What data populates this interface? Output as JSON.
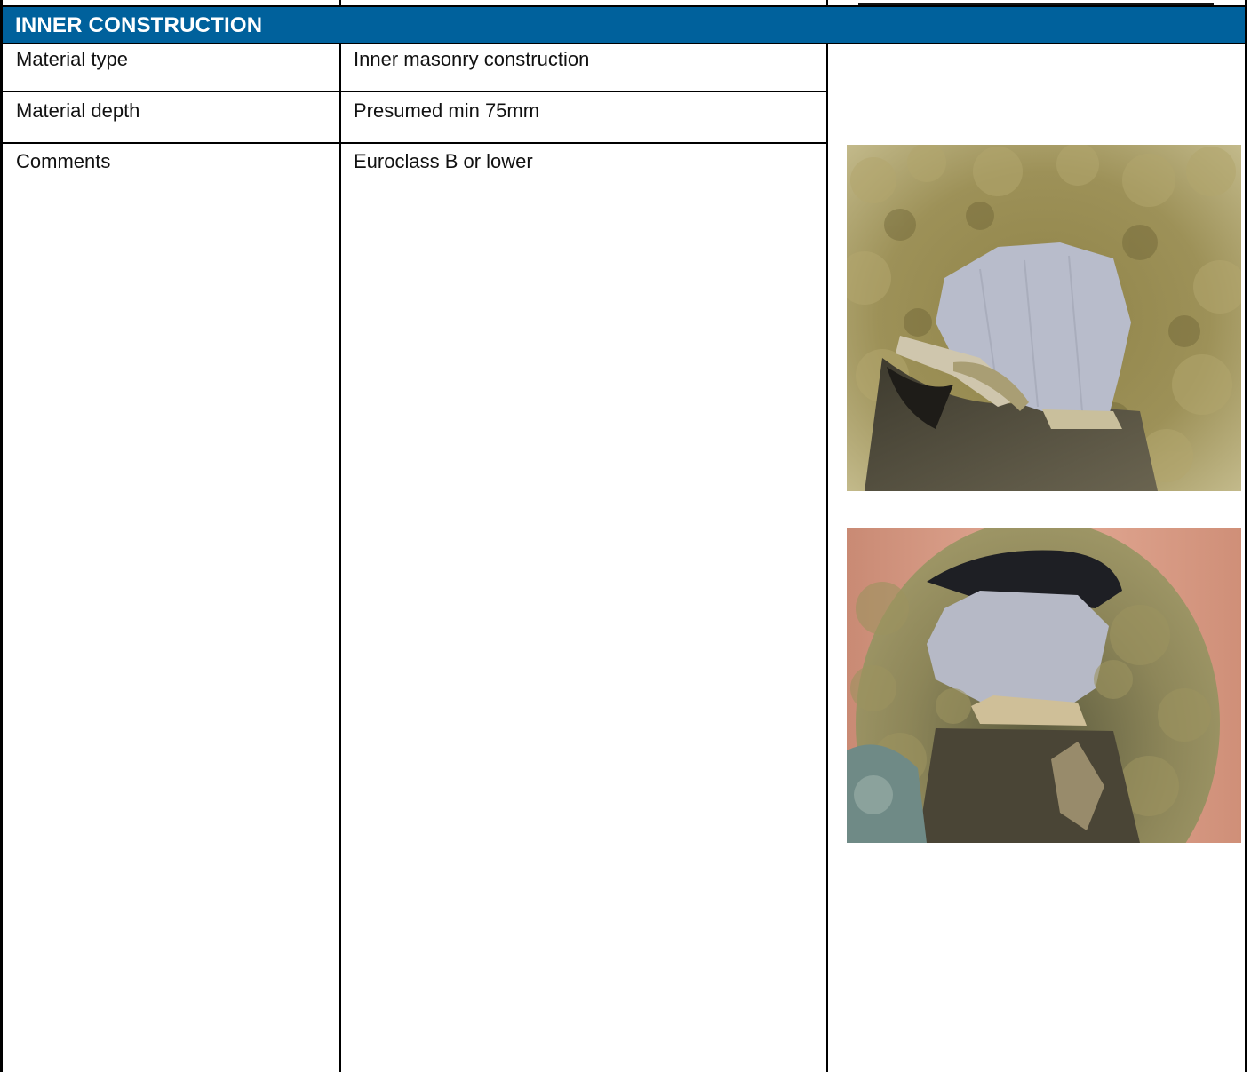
{
  "section": {
    "title": "INNER CONSTRUCTION",
    "header_color": "#00619c"
  },
  "rows": [
    {
      "label": "Material type",
      "value": "Inner masonry construction"
    },
    {
      "label": "Material depth",
      "value": "Presumed min 75mm"
    },
    {
      "label": "Comments",
      "value": "Euroclass B or lower"
    }
  ],
  "photos": [
    {
      "name": "cavity-insulation-photo-1",
      "subject": "cavity with mineral wool insulation around grey block"
    },
    {
      "name": "cavity-insulation-photo-2",
      "subject": "cavity viewed through core hole with insulation"
    }
  ]
}
